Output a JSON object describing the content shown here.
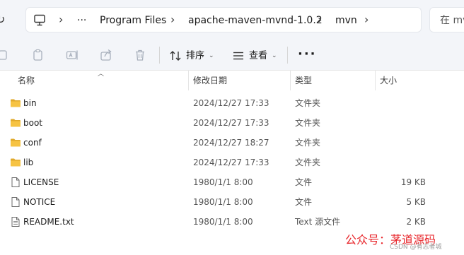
{
  "breadcrumb": {
    "root_icon": "computer-icon",
    "ellipsis": "···",
    "items": [
      "Program Files",
      "apache-maven-mvnd-1.0.2",
      "mvn"
    ],
    "separator": "›"
  },
  "search": {
    "placeholder": "在 mv"
  },
  "toolbar": {
    "sort_label": "排序",
    "view_label": "查看",
    "more_label": "···"
  },
  "columns": {
    "name": "名称",
    "date": "修改日期",
    "type": "类型",
    "size": "大小"
  },
  "files": [
    {
      "name": "bin",
      "date": "2024/12/27 17:33",
      "type": "文件夹",
      "size": "",
      "kind": "folder"
    },
    {
      "name": "boot",
      "date": "2024/12/27 17:33",
      "type": "文件夹",
      "size": "",
      "kind": "folder"
    },
    {
      "name": "conf",
      "date": "2024/12/27 18:27",
      "type": "文件夹",
      "size": "",
      "kind": "folder"
    },
    {
      "name": "lib",
      "date": "2024/12/27 17:33",
      "type": "文件夹",
      "size": "",
      "kind": "folder"
    },
    {
      "name": "LICENSE",
      "date": "1980/1/1 8:00",
      "type": "文件",
      "size": "19 KB",
      "kind": "file"
    },
    {
      "name": "NOTICE",
      "date": "1980/1/1 8:00",
      "type": "文件",
      "size": "5 KB",
      "kind": "file"
    },
    {
      "name": "README.txt",
      "date": "1980/1/1 8:00",
      "type": "Text 源文件",
      "size": "2 KB",
      "kind": "text"
    }
  ],
  "watermark": {
    "text": "公众号：茅道源码",
    "csdn": "CSDN @有志者城"
  },
  "colors": {
    "folder": "#f6c343",
    "folder_dark": "#e0a92b",
    "watermark": "#e8262b",
    "chrome_bg": "#f3f5f9"
  }
}
